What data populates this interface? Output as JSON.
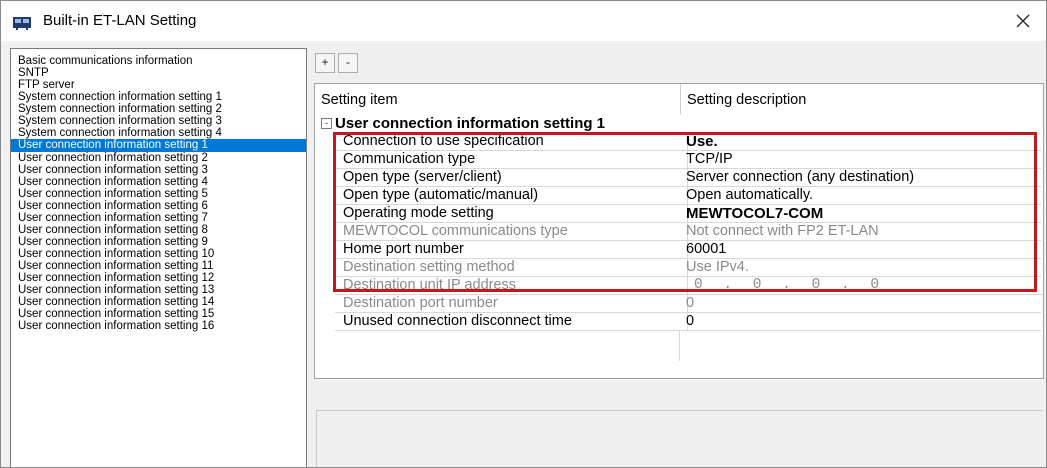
{
  "window": {
    "title": "Built-in ET-LAN Setting"
  },
  "icons": {
    "app": "network-card-icon",
    "close": "close-icon"
  },
  "colors": {
    "selection": "#0078d7",
    "highlight_border": "#c3161e"
  },
  "toolbar": {
    "expand_label": "+",
    "collapse_label": "-"
  },
  "left_list": {
    "items": [
      "Basic communications information",
      "SNTP",
      "FTP server",
      "System connection information setting 1",
      "System connection information setting 2",
      "System connection information setting 3",
      "System connection information setting 4",
      "User connection information setting 1",
      "User connection information setting 2",
      "User connection information setting 3",
      "User connection information setting 4",
      "User connection information setting 5",
      "User connection information setting 6",
      "User connection information setting 7",
      "User connection information setting 8",
      "User connection information setting 9",
      "User connection information setting 10",
      "User connection information setting 11",
      "User connection information setting 12",
      "User connection information setting 13",
      "User connection information setting 14",
      "User connection information setting 15",
      "User connection information setting 16"
    ],
    "selected": "User connection information setting 1"
  },
  "grid": {
    "col_item": "Setting item",
    "col_desc": "Setting description",
    "category": {
      "toggle": "-",
      "label": "User connection information setting 1"
    },
    "rows": [
      {
        "item": "Connection to use specification",
        "value": "Use."
      },
      {
        "item": "Communication type",
        "value": "TCP/IP"
      },
      {
        "item": "Open type (server/client)",
        "value": "Server connection (any destination)"
      },
      {
        "item": "Open type (automatic/manual)",
        "value": "Open automatically."
      },
      {
        "item": "Operating mode setting",
        "value": "MEWTOCOL7-COM"
      },
      {
        "item": "MEWTOCOL communications type",
        "value": "Not connect with FP2 ET-LAN"
      },
      {
        "item": "Home port number",
        "value": "60001"
      },
      {
        "item": "Destination setting method",
        "value": "Use IPv4."
      },
      {
        "item": "Destination unit IP address",
        "value": "0 . 0 . 0 . 0"
      },
      {
        "item": "Destination port number",
        "value": "0"
      },
      {
        "item": "Unused connection disconnect time",
        "value": "0"
      }
    ]
  }
}
